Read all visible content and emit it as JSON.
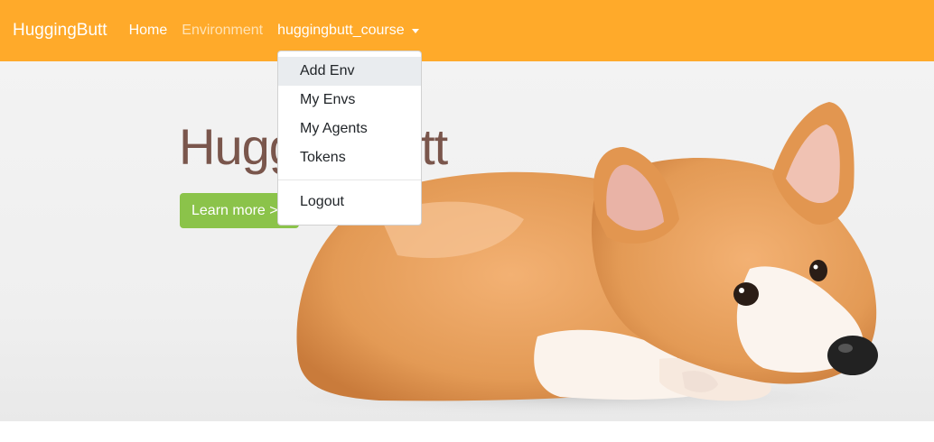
{
  "navbar": {
    "brand": "HuggingButt",
    "links": [
      {
        "label": "Home"
      },
      {
        "label": "Environment"
      }
    ],
    "user_menu": {
      "label": "huggingbutt_course",
      "items": [
        "Add Env",
        "My Envs",
        "My Agents",
        "Tokens"
      ],
      "logout": "Logout"
    }
  },
  "hero": {
    "title": "HuggingButt",
    "button": "Learn more >"
  },
  "colors": {
    "navbar": "#ffaa2a",
    "button": "#8bc34a",
    "title": "#7a564c",
    "hover": "#e9ecef"
  },
  "icons": [
    "caret-down-icon"
  ]
}
